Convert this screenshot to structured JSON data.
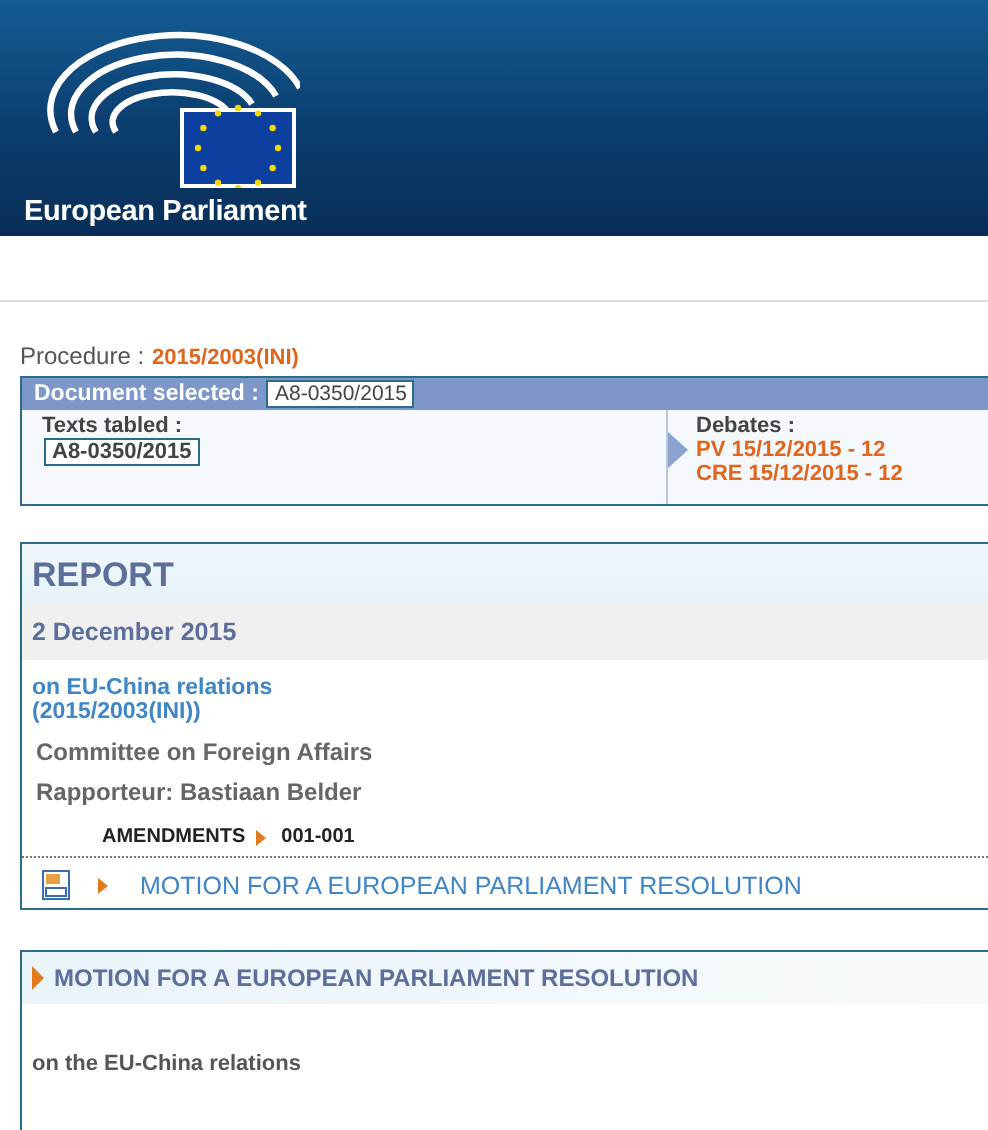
{
  "header": {
    "logo_text": "European Parliament"
  },
  "procedure": {
    "label": "Procedure :",
    "value": "2015/2003(INI)"
  },
  "document_selected": {
    "label": "Document selected :",
    "value": "A8-0350/2015"
  },
  "texts_tabled": {
    "label": "Texts tabled :",
    "value": "A8-0350/2015"
  },
  "debates": {
    "label": "Debates :",
    "links": [
      "PV 15/12/2015 - 12",
      "CRE 15/12/2015 - 12"
    ]
  },
  "report": {
    "title": "REPORT",
    "date": "2 December 2015",
    "subject_lines": [
      "on EU-China relations",
      "(2015/2003(INI))"
    ],
    "committee": "Committee on Foreign Affairs",
    "rapporteur": "Rapporteur: Bastiaan Belder",
    "amendments_label": "AMENDMENTS",
    "amendments_value": "001-001",
    "toc_link": "MOTION FOR A EUROPEAN PARLIAMENT RESOLUTION"
  },
  "motion": {
    "title": "MOTION FOR A EUROPEAN PARLIAMENT RESOLUTION",
    "text": "on the EU-China relations"
  }
}
